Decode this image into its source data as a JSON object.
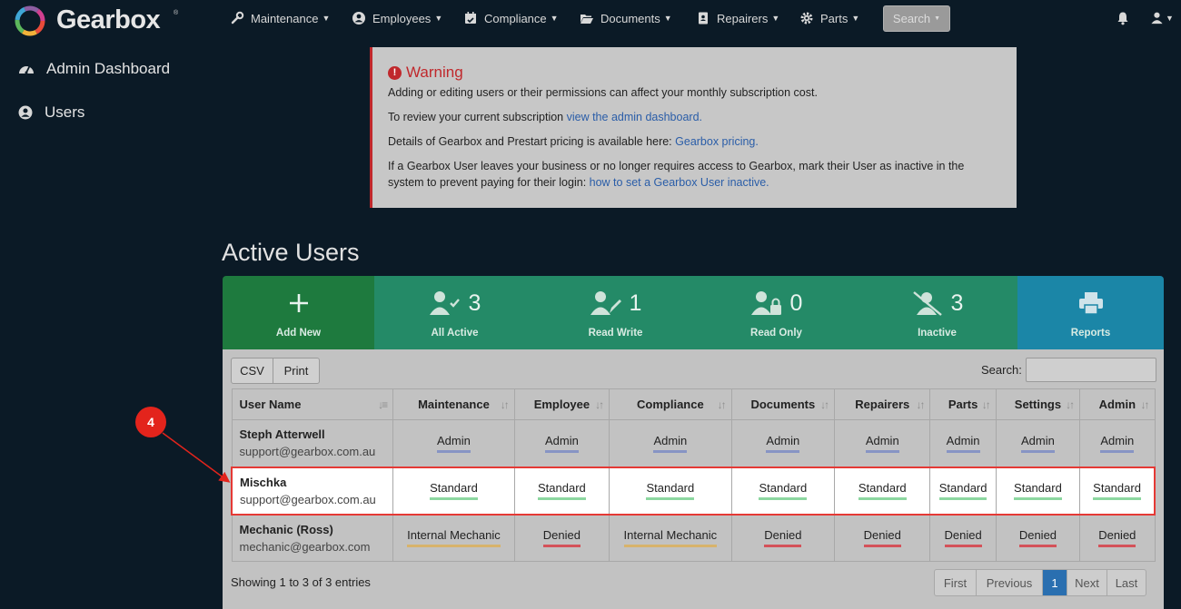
{
  "brand": {
    "name": "Gearbox",
    "tm": "®"
  },
  "nav": {
    "items": [
      {
        "label": "Maintenance",
        "icon": "wrench-icon"
      },
      {
        "label": "Employees",
        "icon": "user-circle-icon"
      },
      {
        "label": "Compliance",
        "icon": "calendar-check-icon"
      },
      {
        "label": "Documents",
        "icon": "folder-open-icon"
      },
      {
        "label": "Repairers",
        "icon": "address-book-icon"
      },
      {
        "label": "Parts",
        "icon": "gear-icon"
      }
    ],
    "search_label": "Search"
  },
  "sidebar": {
    "items": [
      {
        "label": "Admin Dashboard",
        "icon": "dashboard-icon"
      },
      {
        "label": "Users",
        "icon": "user-circle-icon"
      }
    ]
  },
  "warning": {
    "title": "Warning",
    "line1": "Adding or editing users or their permissions can affect your monthly subscription cost.",
    "line2_text": "To review your current subscription ",
    "line2_link": "view the admin dashboard.",
    "line3_text": "Details of Gearbox and Prestart pricing is available here: ",
    "line3_link": "Gearbox pricing.",
    "line4_text": "If a Gearbox User leaves your business or no longer requires access to Gearbox, mark their User as inactive in the system to prevent paying for their login: ",
    "line4_link": "how to set a Gearbox User inactive."
  },
  "page_title": "Active Users",
  "tiles": [
    {
      "label": "Add New",
      "count": "",
      "icon": "plus-icon"
    },
    {
      "label": "All Active",
      "count": "3",
      "icon": "user-check-icon"
    },
    {
      "label": "Read Write",
      "count": "1",
      "icon": "user-edit-icon"
    },
    {
      "label": "Read Only",
      "count": "0",
      "icon": "user-lock-icon"
    },
    {
      "label": "Inactive",
      "count": "3",
      "icon": "user-slash-icon"
    },
    {
      "label": "Reports",
      "count": "",
      "icon": "printer-icon"
    }
  ],
  "table_tools": {
    "csv": "CSV",
    "print": "Print",
    "search_label": "Search:"
  },
  "columns": [
    "User Name",
    "Maintenance",
    "Employee",
    "Compliance",
    "Documents",
    "Repairers",
    "Parts",
    "Settings",
    "Admin"
  ],
  "rows": [
    {
      "name": "Steph Atterwell",
      "email": "support@gearbox.com.au",
      "perms": [
        "Admin",
        "Admin",
        "Admin",
        "Admin",
        "Admin",
        "Admin",
        "Admin",
        "Admin"
      ]
    },
    {
      "name": "Mischka",
      "email": "support@gearbox.com.au",
      "perms": [
        "Standard",
        "Standard",
        "Standard",
        "Standard",
        "Standard",
        "Standard",
        "Standard",
        "Standard"
      ]
    },
    {
      "name": "Mechanic (Ross)",
      "email": "mechanic@gearbox.com",
      "perms": [
        "Internal Mechanic",
        "Denied",
        "Internal Mechanic",
        "Denied",
        "Denied",
        "Denied",
        "Denied",
        "Denied"
      ]
    }
  ],
  "footer": {
    "info": "Showing 1 to 3 of 3 entries",
    "pager": [
      "First",
      "Previous",
      "1",
      "Next",
      "Last"
    ]
  },
  "callout": {
    "number": "4"
  },
  "colors": {
    "admin_underline": "#8794c4",
    "standard_underline": "#8cd7a0",
    "denied_underline": "#d4525a",
    "mechanic_underline": "#d8b36b",
    "highlight": "#e53935"
  }
}
